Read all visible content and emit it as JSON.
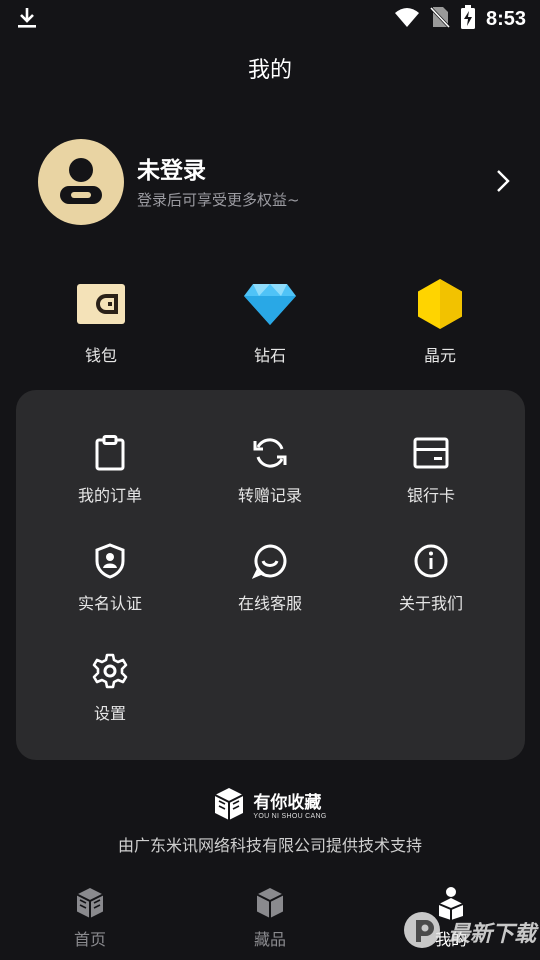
{
  "status_bar": {
    "time": "8:53"
  },
  "page": {
    "title": "我的"
  },
  "profile": {
    "name": "未登录",
    "subtitle": "登录后可享受更多权益~"
  },
  "wallet": [
    {
      "label": "钱包",
      "icon": "wallet-icon"
    },
    {
      "label": "钻石",
      "icon": "diamond-icon"
    },
    {
      "label": "晶元",
      "icon": "hexagon-coin-icon"
    }
  ],
  "menu": [
    {
      "label": "我的订单",
      "icon": "clipboard-icon"
    },
    {
      "label": "转赠记录",
      "icon": "refresh-icon"
    },
    {
      "label": "银行卡",
      "icon": "bank-card-icon"
    },
    {
      "label": "实名认证",
      "icon": "id-shield-icon"
    },
    {
      "label": "在线客服",
      "icon": "chat-smile-icon"
    },
    {
      "label": "关于我们",
      "icon": "info-icon"
    },
    {
      "label": "设置",
      "icon": "settings-gear-icon"
    }
  ],
  "brand": {
    "name": "有你收藏",
    "sub": "YOU NI SHOU CANG"
  },
  "footer": {
    "support": "由广东米讯网络科技有限公司提供技术支持"
  },
  "nav": [
    {
      "label": "首页",
      "icon": "home-cube-icon",
      "active": false
    },
    {
      "label": "藏品",
      "icon": "box-icon",
      "active": false
    },
    {
      "label": "我的",
      "icon": "person-cube-icon",
      "active": true
    }
  ],
  "watermark": {
    "text": "最新下载"
  },
  "colors": {
    "background": "#141417",
    "card": "#2b2b2d",
    "avatar": "#e9d4a3",
    "diamond": "#4fc3f7",
    "coin": "#ffd400"
  }
}
